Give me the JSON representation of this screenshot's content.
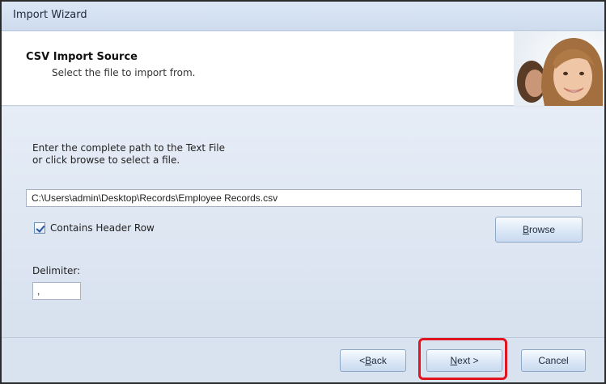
{
  "window": {
    "title": "Import Wizard"
  },
  "header": {
    "title": "CSV Import Source",
    "subtitle": "Select the file to import from."
  },
  "main": {
    "instruction_line1": "Enter the complete path to the Text File",
    "instruction_line2": "or click browse to select a file.",
    "file_path": "C:\\Users\\admin\\Desktop\\Records\\Employee Records.csv",
    "contains_header_label": "Contains Header Row",
    "contains_header_checked": true,
    "browse_label": "Browse",
    "browse_access_key": "B",
    "browse_rest": "rowse",
    "delimiter_label": "Delimiter:",
    "delimiter_value": ","
  },
  "footer": {
    "back_prefix": "< ",
    "back_access_key": "B",
    "back_rest": "ack",
    "next_access_key": "N",
    "next_rest": "ext >",
    "cancel_label": "Cancel"
  },
  "colors": {
    "highlight": "#e0151f",
    "window_bg": "#dde6f1",
    "accent": "#2455a4"
  },
  "icons": {
    "header_photo": "people-photo-icon",
    "check": "checkmark-icon"
  }
}
